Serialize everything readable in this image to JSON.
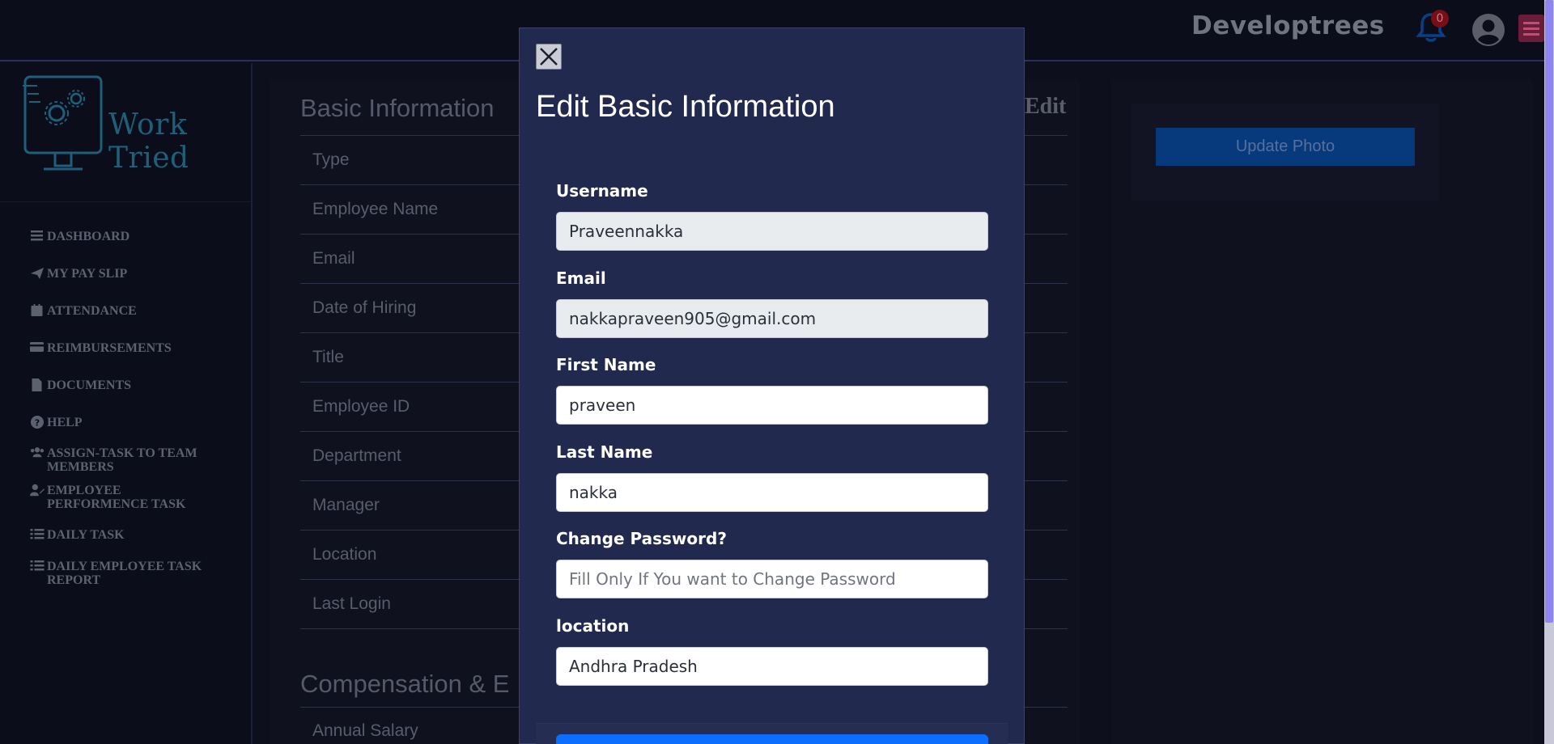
{
  "header": {
    "brand": "Developtrees",
    "notification_count": "0"
  },
  "sidebar": {
    "logo_text": "Work Tried",
    "items": [
      {
        "icon": "menu-icon",
        "label": "DASHBOARD"
      },
      {
        "icon": "paper-plane-icon",
        "label": "MY PAY SLIP"
      },
      {
        "icon": "calendar-icon",
        "label": "ATTENDANCE"
      },
      {
        "icon": "credit-card-icon",
        "label": "REIMBURSEMENTS"
      },
      {
        "icon": "file-icon",
        "label": "DOCUMENTS"
      },
      {
        "icon": "question-circle-icon",
        "label": "HELP"
      },
      {
        "icon": "users-icon",
        "label": "ASSIGN-TASK TO TEAM MEMBERS"
      },
      {
        "icon": "user-edit-icon",
        "label": "EMPLOYEE PERFORMENCE TASK"
      },
      {
        "icon": "list-check-icon",
        "label": "DAILY TASK"
      },
      {
        "icon": "list-check-icon",
        "label": "DAILY EMPLOYEE TASK REPORT"
      }
    ]
  },
  "main": {
    "basic_info_title": "Basic Information",
    "edit_label": "Edit",
    "rows": [
      "Type",
      "Employee Name",
      "Email",
      "Date of Hiring",
      "Title",
      "Employee ID",
      "Department",
      "Manager",
      "Location",
      "Last Login"
    ],
    "compensation_title": "Compensation & E",
    "compensation_rows": [
      "Annual Salary"
    ],
    "update_photo_label": "Update Photo"
  },
  "modal": {
    "title": "Edit Basic Information",
    "fields": {
      "username": {
        "label": "Username",
        "value": "Praveennakka"
      },
      "email": {
        "label": "Email",
        "value": "nakkapraveen905@gmail.com"
      },
      "first_name": {
        "label": "First Name",
        "value": "praveen"
      },
      "last_name": {
        "label": "Last Name",
        "value": "nakka"
      },
      "password": {
        "label": "Change Password?",
        "value": "",
        "placeholder": "Fill Only If You want to Change Password"
      },
      "location": {
        "label": "location",
        "value": "Andhra Pradesh"
      }
    }
  },
  "colors": {
    "modal_bg": "#22294e",
    "primary": "#0d6efd",
    "page_bg": "#0d0f1c"
  }
}
